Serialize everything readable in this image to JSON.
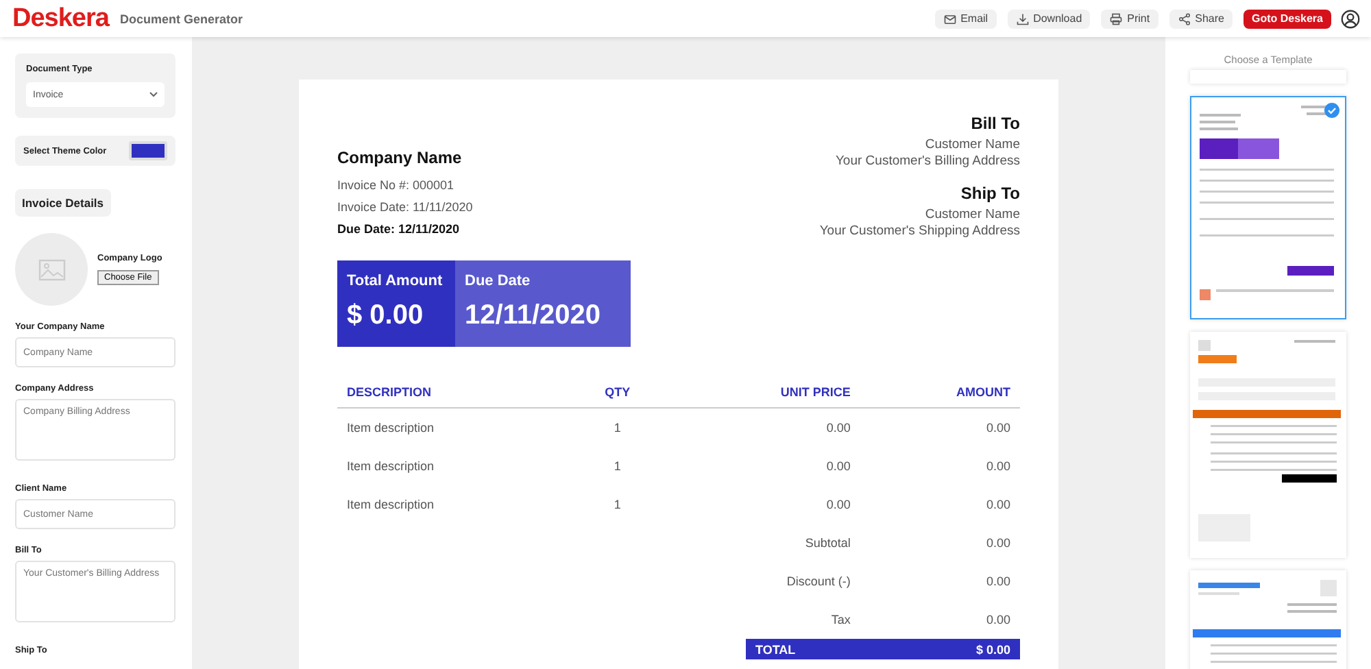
{
  "header": {
    "logo": "Deskera",
    "subtitle": "Document Generator",
    "actions": [
      {
        "label": "Email",
        "kind": "email"
      },
      {
        "label": "Download",
        "kind": "download"
      },
      {
        "label": "Print",
        "kind": "print"
      },
      {
        "label": "Share",
        "kind": "share"
      }
    ],
    "cta": "Goto Deskera"
  },
  "sidebar": {
    "document_type": {
      "label": "Document Type",
      "value": "Invoice"
    },
    "theme": {
      "label": "Select Theme Color",
      "color": "#3030c0"
    },
    "section": "Invoice Details",
    "logo": {
      "label": "Company Logo",
      "button": "Choose File"
    },
    "fields": [
      {
        "label": "Your Company Name",
        "placeholder": "Company Name",
        "kind": "input"
      },
      {
        "label": "Company Address",
        "placeholder": "Company Billing Address",
        "kind": "textarea"
      },
      {
        "label": "Client Name",
        "placeholder": "Customer Name",
        "kind": "input"
      },
      {
        "label": "Bill To",
        "placeholder": "Your Customer's Billing Address",
        "kind": "textarea"
      },
      {
        "label": "Ship To",
        "kind": "label"
      }
    ]
  },
  "document": {
    "company": "Company Name",
    "invoice_no": "Invoice No #: 000001",
    "invoice_date": "Invoice Date: 11/11/2020",
    "due_date": "Due Date: 12/11/2020",
    "bill_to": {
      "title": "Bill To",
      "name": "Customer Name",
      "address": "Your Customer's Billing Address"
    },
    "ship_to": {
      "title": "Ship To",
      "name": "Customer Name",
      "address": "Your Customer's Shipping Address"
    },
    "total_amount": {
      "label": "Total Amount",
      "value": "$ 0.00"
    },
    "due": {
      "label": "Due Date",
      "value": "12/11/2020"
    },
    "columns": [
      "DESCRIPTION",
      "QTY",
      "UNIT PRICE",
      "AMOUNT"
    ],
    "rows": [
      [
        "Item description",
        "1",
        "0.00",
        "0.00"
      ],
      [
        "Item description",
        "1",
        "0.00",
        "0.00"
      ],
      [
        "Item description",
        "1",
        "0.00",
        "0.00"
      ]
    ],
    "summary": [
      {
        "label": "Subtotal",
        "value": "0.00"
      },
      {
        "label": "Discount (-)",
        "value": "0.00"
      },
      {
        "label": "Tax",
        "value": "0.00"
      }
    ],
    "total": {
      "label": "TOTAL",
      "value": "$ 0.00"
    }
  },
  "templates": {
    "title": "Choose a Template",
    "items": [
      {
        "kind": "plain",
        "selected": false
      },
      {
        "kind": "purple",
        "selected": true
      },
      {
        "kind": "orange",
        "selected": false
      },
      {
        "kind": "blue",
        "selected": false
      }
    ]
  }
}
